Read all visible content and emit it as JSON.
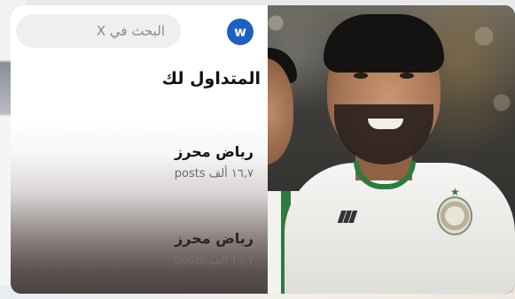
{
  "panel": {
    "avatar_letter": "w",
    "search_placeholder": "البحث في X",
    "heading": "المتداول لك",
    "trends": [
      {
        "name": "رياض محرز",
        "count": "١٦,٧ ألف posts"
      },
      {
        "name": "رياض محرز",
        "count": "١٦,٧ ألف posts"
      }
    ]
  },
  "colors": {
    "avatar": "#1f5fbf",
    "jersey_green": "#2f7a3f"
  },
  "photo": {
    "subject": "two football players in white Algeria jerseys"
  }
}
